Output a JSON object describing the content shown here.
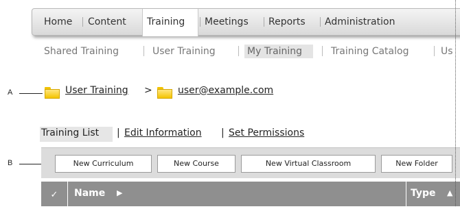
{
  "top_nav": {
    "items": [
      "Home",
      "Content",
      "Training",
      "Meetings",
      "Reports",
      "Administration"
    ],
    "active": "Training"
  },
  "sub_nav": {
    "items": [
      "Shared Training",
      "User Training",
      "My Training",
      "Training Catalog",
      "Us"
    ],
    "active": "My Training"
  },
  "breadcrumb": {
    "root": "User Training",
    "separator": ">",
    "current": "user@example.com"
  },
  "callouts": {
    "a": "A",
    "b": "B"
  },
  "sub_tabs": {
    "items": [
      "Training List",
      "Edit Information",
      "Set Permissions"
    ],
    "active": "Training List",
    "separator": "|"
  },
  "toolbar": {
    "buttons": [
      "New Curriculum",
      "New Course",
      "New Virtual Classroom",
      "New Folder"
    ]
  },
  "table": {
    "check_icon": "checkmark-icon",
    "columns": [
      "Name",
      "Type"
    ]
  },
  "colors": {
    "folder": "#f4c400",
    "table_header": "#8f8f8f",
    "toolbar": "#dcdcdc"
  }
}
